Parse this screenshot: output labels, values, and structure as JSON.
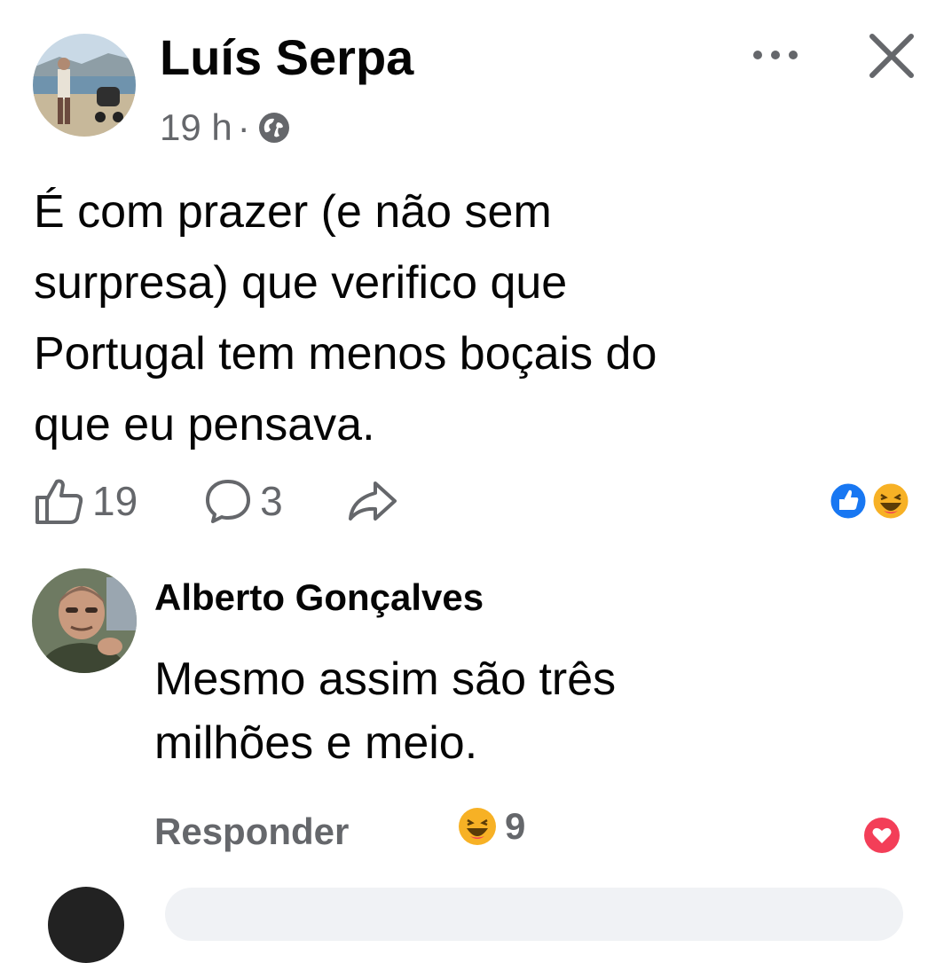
{
  "post": {
    "author": "Luís Serpa",
    "time": "19 h",
    "separator": "·",
    "privacy_icon": "globe-icon",
    "text_lines": [
      "É com prazer (e não sem",
      "surpresa) que verifico que",
      "Portugal tem menos boçais do",
      "que eu pensava."
    ],
    "like_count": "19",
    "comment_count": "3",
    "reactions": [
      "like",
      "haha"
    ],
    "colors": {
      "like_blue": "#1877f2",
      "haha_yellow": "#f7b125",
      "love_red": "#f33e58",
      "secondary_text": "#65676b"
    }
  },
  "comment": {
    "author": "Alberto Gonçalves",
    "text_lines": [
      "Mesmo assim são três",
      "milhões e meio."
    ],
    "reply_label": "Responder",
    "haha_count": "9",
    "reactions": [
      "haha",
      "love"
    ]
  }
}
